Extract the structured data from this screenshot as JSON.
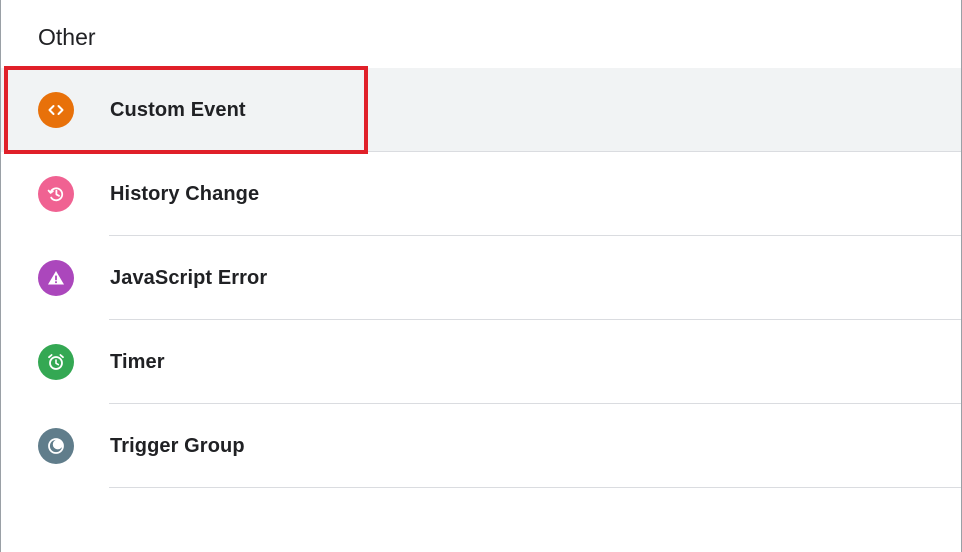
{
  "section": {
    "title": "Other"
  },
  "items": [
    {
      "label": "Custom Event",
      "icon": "code-icon",
      "color": "#e8710a"
    },
    {
      "label": "History Change",
      "icon": "history-icon",
      "color": "#f06292"
    },
    {
      "label": "JavaScript Error",
      "icon": "warning-icon",
      "color": "#ab47bc"
    },
    {
      "label": "Timer",
      "icon": "alarm-clock-icon",
      "color": "#34a853"
    },
    {
      "label": "Trigger Group",
      "icon": "trigger-group-icon",
      "color": "#607d8b"
    }
  ],
  "highlight": {
    "color": "#e02029",
    "target": "Custom Event"
  },
  "selection_background": "#f1f3f4"
}
